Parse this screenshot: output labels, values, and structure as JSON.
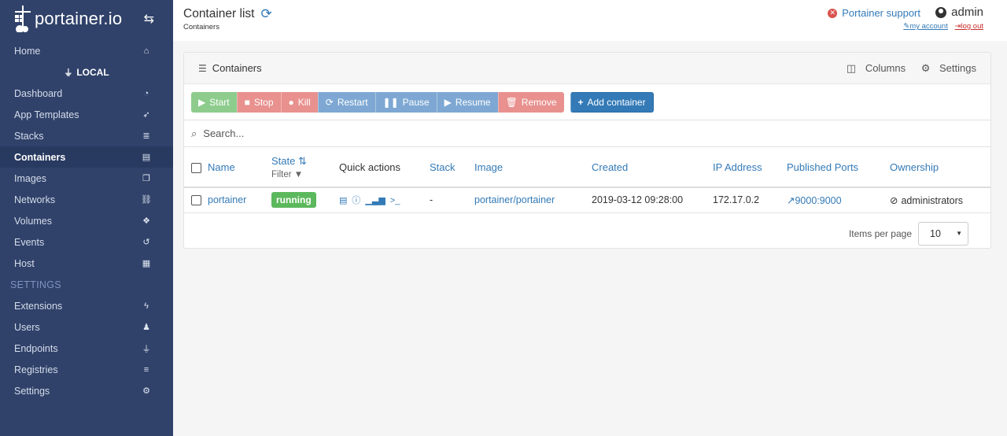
{
  "brand": {
    "name": "portainer.io"
  },
  "sidebar": {
    "items": [
      {
        "label": "Home",
        "icon": "home-icon",
        "glyph": "⌂"
      },
      {
        "label": "Dashboard",
        "icon": "tachometer-icon",
        "glyph": "◔"
      },
      {
        "label": "App Templates",
        "icon": "rocket-icon",
        "glyph": "➶"
      },
      {
        "label": "Stacks",
        "icon": "th-list-icon",
        "glyph": "≣"
      },
      {
        "label": "Containers",
        "icon": "server-icon",
        "glyph": "▤"
      },
      {
        "label": "Images",
        "icon": "clone-icon",
        "glyph": "❐"
      },
      {
        "label": "Networks",
        "icon": "sitemap-icon",
        "glyph": "⛓"
      },
      {
        "label": "Volumes",
        "icon": "cubes-icon",
        "glyph": "❖"
      },
      {
        "label": "Events",
        "icon": "history-icon",
        "glyph": "↺"
      },
      {
        "label": "Host",
        "icon": "th-icon",
        "glyph": "▦"
      }
    ],
    "endpoint_label": "LOCAL",
    "settings_section": "SETTINGS",
    "settings_items": [
      {
        "label": "Extensions",
        "icon": "bolt-icon",
        "glyph": "ϟ"
      },
      {
        "label": "Users",
        "icon": "users-icon",
        "glyph": "👥"
      },
      {
        "label": "Endpoints",
        "icon": "plug-icon",
        "glyph": "⏚"
      },
      {
        "label": "Registries",
        "icon": "database-icon",
        "glyph": "≡"
      },
      {
        "label": "Settings",
        "icon": "cogs-icon",
        "glyph": "⚙"
      }
    ]
  },
  "header": {
    "title": "Container list",
    "breadcrumb": "Containers",
    "support": "Portainer support",
    "username": "admin",
    "my_account": "my account",
    "logout": "log out"
  },
  "panel": {
    "title": "Containers",
    "columns_label": "Columns",
    "settings_label": "Settings",
    "buttons": {
      "start": "Start",
      "stop": "Stop",
      "kill": "Kill",
      "restart": "Restart",
      "pause": "Pause",
      "resume": "Resume",
      "remove": "Remove",
      "add": "Add container"
    },
    "search_placeholder": "Search...",
    "table": {
      "headers": {
        "name": "Name",
        "state": "State",
        "filter": "Filter",
        "quick_actions": "Quick actions",
        "stack": "Stack",
        "image": "Image",
        "created": "Created",
        "ip": "IP Address",
        "ports": "Published Ports",
        "ownership": "Ownership"
      },
      "rows": [
        {
          "name": "portainer",
          "state": "running",
          "stack": "-",
          "image": "portainer/portainer",
          "created": "2019-03-12 09:28:00",
          "ip": "172.17.0.2",
          "ports": "9000:9000",
          "ownership": "administrators"
        }
      ]
    },
    "pagination": {
      "label": "Items per page",
      "value": "10"
    }
  }
}
